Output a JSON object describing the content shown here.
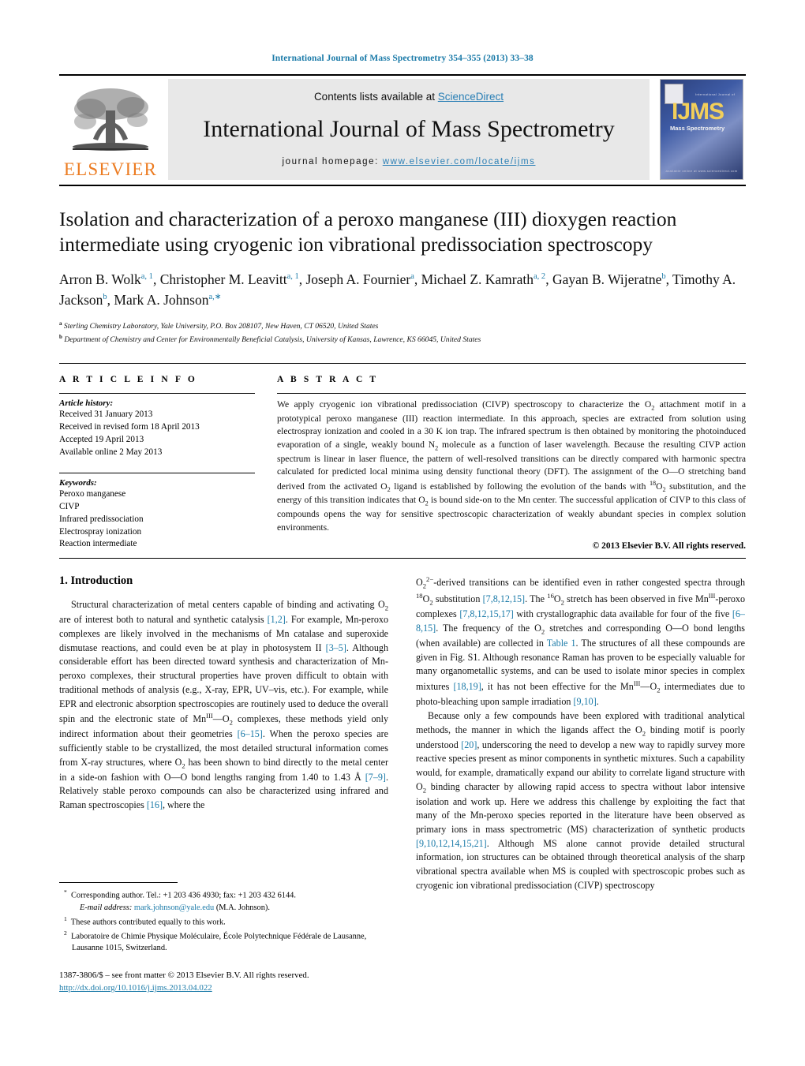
{
  "running_head": "International Journal of Mass Spectrometry 354–355 (2013) 33–38",
  "masthead": {
    "contents_prefix": "Contents lists available at ",
    "sciencedirect": "ScienceDirect",
    "journal_title": "International Journal of Mass Spectrometry",
    "homepage_label": "journal homepage: ",
    "homepage_url": "www.elsevier.com/locate/ijms",
    "publisher": "ELSEVIER",
    "cover": {
      "acronym": "IJMS",
      "subtitle": "Mass Spectrometry",
      "top_line": "International Journal of",
      "bottom_line": "available online at www.sciencedirect.com"
    }
  },
  "article": {
    "title": "Isolation and characterization of a peroxo manganese (III) dioxygen reaction intermediate using cryogenic ion vibrational predissociation spectroscopy",
    "authors_html": "Arron B. Wolk<sup>a, 1</sup>, Christopher M. Leavitt<sup>a, 1</sup>, Joseph A. Fournier<sup>a</sup>, Michael Z. Kamrath<sup>a, 2</sup>, Gayan B. Wijeratne<sup>b</sup>, Timothy A. Jackson<sup>b</sup>, Mark A. Johnson<sup>a,∗</sup>",
    "affiliations": [
      {
        "marker": "a",
        "text": "Sterling Chemistry Laboratory, Yale University, P.O. Box 208107, New Haven, CT 06520, United States"
      },
      {
        "marker": "b",
        "text": "Department of Chemistry and Center for Environmentally Beneficial Catalysis, University of Kansas, Lawrence, KS 66045, United States"
      }
    ]
  },
  "article_info": {
    "heading": "A R T I C L E   I N F O",
    "history_label": "Article history:",
    "history": [
      "Received 31 January 2013",
      "Received in revised form 18 April 2013",
      "Accepted 19 April 2013",
      "Available online 2 May 2013"
    ],
    "keywords_label": "Keywords:",
    "keywords": [
      "Peroxo manganese",
      "CIVP",
      "Infrared predissociation",
      "Electrospray ionization",
      "Reaction intermediate"
    ]
  },
  "abstract": {
    "heading": "A B S T R A C T",
    "body_html": "We apply cryogenic ion vibrational predissociation (CIVP) spectroscopy to characterize the O<sub>2</sub> attachment motif in a prototypical peroxo manganese (III) reaction intermediate. In this approach, species are extracted from solution using electrospray ionization and cooled in a 30 K ion trap. The infrared spectrum is then obtained by monitoring the photoinduced evaporation of a single, weakly bound N<sub>2</sub> molecule as a function of laser wavelength. Because the resulting CIVP action spectrum is linear in laser fluence, the pattern of well-resolved transitions can be directly compared with harmonic spectra calculated for predicted local minima using density functional theory (DFT). The assignment of the O—O stretching band derived from the activated O<sub>2</sub> ligand is established by following the evolution of the bands with <sup>18</sup>O<sub>2</sub> substitution, and the energy of this transition indicates that O<sub>2</sub> is bound side-on to the Mn center. The successful application of CIVP to this class of compounds opens the way for sensitive spectroscopic characterization of weakly abundant species in complex solution environments.",
    "copyright": "© 2013 Elsevier B.V. All rights reserved."
  },
  "sections": {
    "intro_heading": "1.  Introduction",
    "left_column": [
      "Structural characterization of metal centers capable of binding and activating O<sub>2</sub> are of interest both to natural and synthetic catalysis <span class=\"ref\">[1,2]</span>. For example, Mn-peroxo complexes are likely involved in the mechanisms of Mn catalase and superoxide dismutase reactions, and could even be at play in photosystem II <span class=\"ref\">[3–5]</span>. Although considerable effort has been directed toward synthesis and characterization of Mn-peroxo complexes, their structural properties have proven difficult to obtain with traditional methods of analysis (e.g., X-ray, EPR, UV–vis, etc.). For example, while EPR and electronic absorption spectroscopies are routinely used to deduce the overall spin and the electronic state of Mn<sup>III</sup>—O<sub>2</sub> complexes, these methods yield only indirect information about their geometries <span class=\"ref\">[6–15]</span>. When the peroxo species are sufficiently stable to be crystallized, the most detailed structural information comes from X-ray structures, where O<sub>2</sub> has been shown to bind directly to the metal center in a side-on fashion with O—O bond lengths ranging from 1.40 to 1.43 Å <span class=\"ref\">[7–9]</span>. Relatively stable peroxo compounds can also be characterized using infrared and Raman spectroscopies <span class=\"ref\">[16]</span>, where the"
    ],
    "right_column": [
      "O<sub>2</sub><sup>2−</sup>-derived transitions can be identified even in rather congested spectra through <sup>18</sup>O<sub>2</sub> substitution <span class=\"ref\">[7,8,12,15]</span>. The <sup>16</sup>O<sub>2</sub> stretch has been observed in five Mn<sup>III</sup>-peroxo complexes <span class=\"ref\">[7,8,12,15,17]</span> with crystallographic data available for four of the five <span class=\"ref\">[6–8,15]</span>. The frequency of the O<sub>2</sub> stretches and corresponding O—O bond lengths (when available) are collected in <span class=\"ref\">Table 1</span>. The structures of all these compounds are given in Fig. S1. Although resonance Raman has proven to be especially valuable for many organometallic systems, and can be used to isolate minor species in complex mixtures <span class=\"ref\">[18,19]</span>, it has not been effective for the Mn<sup>III</sup>—O<sub>2</sub> intermediates due to photo-bleaching upon sample irradiation <span class=\"ref\">[9,10]</span>.",
      "Because only a few compounds have been explored with traditional analytical methods, the manner in which the ligands affect the O<sub>2</sub> binding motif is poorly understood <span class=\"ref\">[20]</span>, underscoring the need to develop a new way to rapidly survey more reactive species present as minor components in synthetic mixtures. Such a capability would, for example, dramatically expand our ability to correlate ligand structure with O<sub>2</sub> binding character by allowing rapid access to spectra without labor intensive isolation and work up. Here we address this challenge by exploiting the fact that many of the Mn-peroxo species reported in the literature have been observed as primary ions in mass spectrometric (MS) characterization of synthetic products <span class=\"ref\">[9,10,12,14,15,21]</span>. Although MS alone cannot provide detailed structural information, ion structures can be obtained through theoretical analysis of the sharp vibrational spectra available when MS is coupled with spectroscopic probes such as cryogenic ion vibrational predissociation (CIVP) spectroscopy"
    ]
  },
  "footnotes": [
    "<sup>*</sup>&nbsp; Corresponding author. Tel.: +1 203 436 4930; fax: +1 203 432 6144.",
    "<i>E-mail address:</i> <span class=\"ref\">mark.johnson@yale.edu</span> (M.A. Johnson).",
    "<sup>1</sup>&nbsp; These authors contributed equally to this work.",
    "<sup>2</sup>&nbsp; Laboratoire de Chimie Physique Moléculaire, École Polytechnique Fédérale de Lausanne, Lausanne 1015, Switzerland."
  ],
  "imprint": {
    "line1": "1387-3806/$ – see front matter © 2013 Elsevier B.V. All rights reserved.",
    "doi": "http://dx.doi.org/10.1016/j.ijms.2013.04.022"
  },
  "colors": {
    "link": "#1a7aa8",
    "elsevier_orange": "#ec7c22",
    "masthead_bg": "#e8e8e8"
  }
}
